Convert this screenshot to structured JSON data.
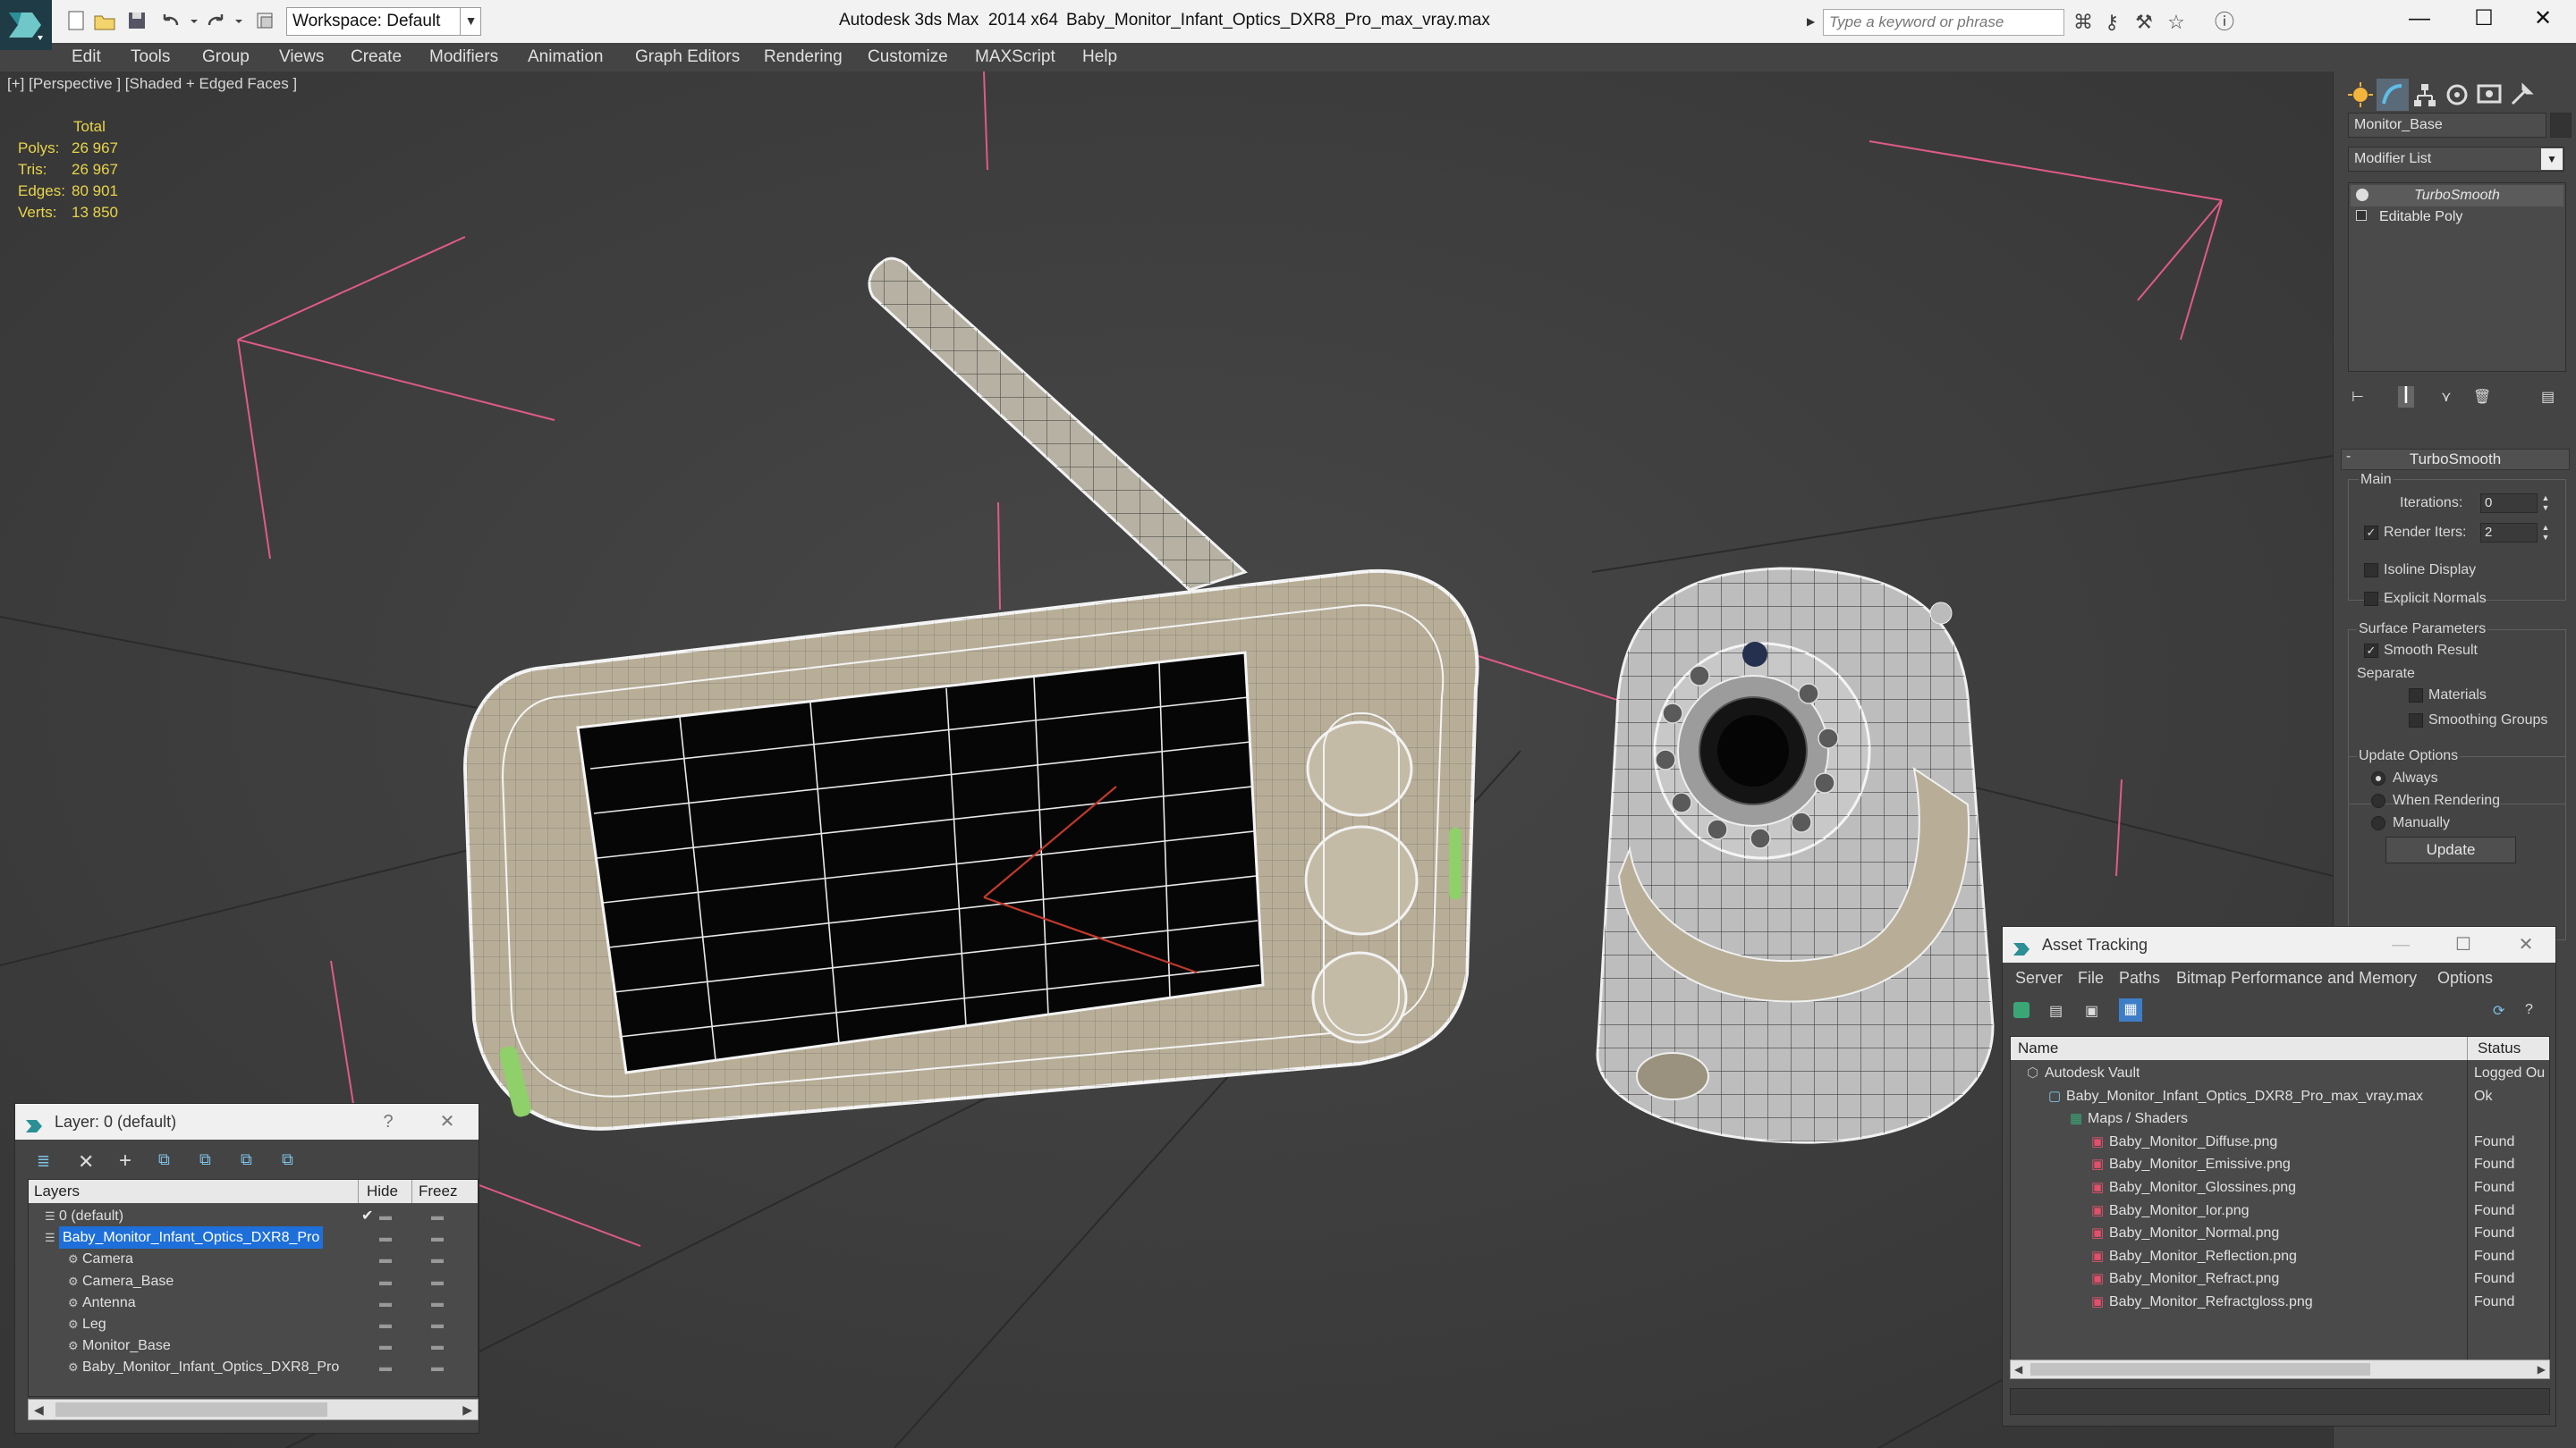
{
  "window": {
    "app_title": "Autodesk 3ds Max  2014 x64",
    "file_title": "Baby_Monitor_Infant_Optics_DXR8_Pro_max_vray.max",
    "workspace": "Workspace: Default",
    "search_placeholder": "Type a keyword or phrase",
    "minimize": "—",
    "maximize": "☐",
    "close": "✕"
  },
  "menu": [
    "Edit",
    "Tools",
    "Group",
    "Views",
    "Create",
    "Modifiers",
    "Animation",
    "Graph Editors",
    "Rendering",
    "Customize",
    "MAXScript",
    "Help"
  ],
  "viewport": {
    "label": "[+] [Perspective ] [Shaded + Edged Faces ]",
    "stats": {
      "header": "Total",
      "rows": [
        {
          "label": "Polys:",
          "value": "26 967"
        },
        {
          "label": "Tris:",
          "value": "26 967"
        },
        {
          "label": "Edges:",
          "value": "80 901"
        },
        {
          "label": "Verts:",
          "value": "13 850"
        }
      ]
    }
  },
  "command_panel": {
    "object_name": "Monitor_Base",
    "modifier_list": "Modifier List",
    "stack": [
      "TurboSmooth",
      "Editable Poly"
    ],
    "rollout_title": "TurboSmooth",
    "main_label": "Main",
    "iterations_label": "Iterations:",
    "iterations_value": "0",
    "render_iters_label": "Render Iters:",
    "render_iters_value": "2",
    "isoline": "Isoline Display",
    "explicit_normals": "Explicit Normals",
    "surface_params": "Surface Parameters",
    "smooth_result": "Smooth Result",
    "separate": "Separate",
    "materials": "Materials",
    "smoothing_groups": "Smoothing Groups",
    "update_options": "Update Options",
    "always": "Always",
    "when_rendering": "When Rendering",
    "manually": "Manually",
    "update_button": "Update"
  },
  "layer_window": {
    "title": "Layer: 0 (default)",
    "help": "?",
    "close": "✕",
    "columns": [
      "Layers",
      "Hide",
      "Freez"
    ],
    "rows": [
      {
        "name": "0 (default)",
        "indent": 1,
        "selected": false
      },
      {
        "name": "Baby_Monitor_Infant_Optics_DXR8_Pro",
        "indent": 1,
        "selected": true
      },
      {
        "name": "Camera",
        "indent": 2,
        "selected": false
      },
      {
        "name": "Camera_Base",
        "indent": 2,
        "selected": false
      },
      {
        "name": "Antenna",
        "indent": 2,
        "selected": false
      },
      {
        "name": "Leg",
        "indent": 2,
        "selected": false
      },
      {
        "name": "Monitor_Base",
        "indent": 2,
        "selected": false
      },
      {
        "name": "Baby_Monitor_Infant_Optics_DXR8_Pro",
        "indent": 2,
        "selected": false
      }
    ]
  },
  "asset_window": {
    "title": "Asset Tracking",
    "menu": [
      "Server",
      "File",
      "Paths",
      "Bitmap Performance and Memory",
      "Options"
    ],
    "columns": [
      "Name",
      "Status"
    ],
    "rows": [
      {
        "name": "Autodesk Vault",
        "status": "Logged Ou",
        "indent": 0,
        "icon": "vault"
      },
      {
        "name": "Baby_Monitor_Infant_Optics_DXR8_Pro_max_vray.max",
        "status": "Ok",
        "indent": 1,
        "icon": "max"
      },
      {
        "name": "Maps / Shaders",
        "status": "",
        "indent": 2,
        "icon": "maps"
      },
      {
        "name": "Baby_Monitor_Diffuse.png",
        "status": "Found",
        "indent": 3,
        "icon": "png"
      },
      {
        "name": "Baby_Monitor_Emissive.png",
        "status": "Found",
        "indent": 3,
        "icon": "png"
      },
      {
        "name": "Baby_Monitor_Glossines.png",
        "status": "Found",
        "indent": 3,
        "icon": "png"
      },
      {
        "name": "Baby_Monitor_Ior.png",
        "status": "Found",
        "indent": 3,
        "icon": "png"
      },
      {
        "name": "Baby_Monitor_Normal.png",
        "status": "Found",
        "indent": 3,
        "icon": "png"
      },
      {
        "name": "Baby_Monitor_Reflection.png",
        "status": "Found",
        "indent": 3,
        "icon": "png"
      },
      {
        "name": "Baby_Monitor_Refract.png",
        "status": "Found",
        "indent": 3,
        "icon": "png"
      },
      {
        "name": "Baby_Monitor_Refractgloss.png",
        "status": "Found",
        "indent": 3,
        "icon": "png"
      }
    ]
  },
  "colors": {
    "accent_blue": "#1e6fd9",
    "stats_yellow": "#e8d44a",
    "selection_pink": "#e05a8a",
    "model_beige": "#b8ae98"
  }
}
